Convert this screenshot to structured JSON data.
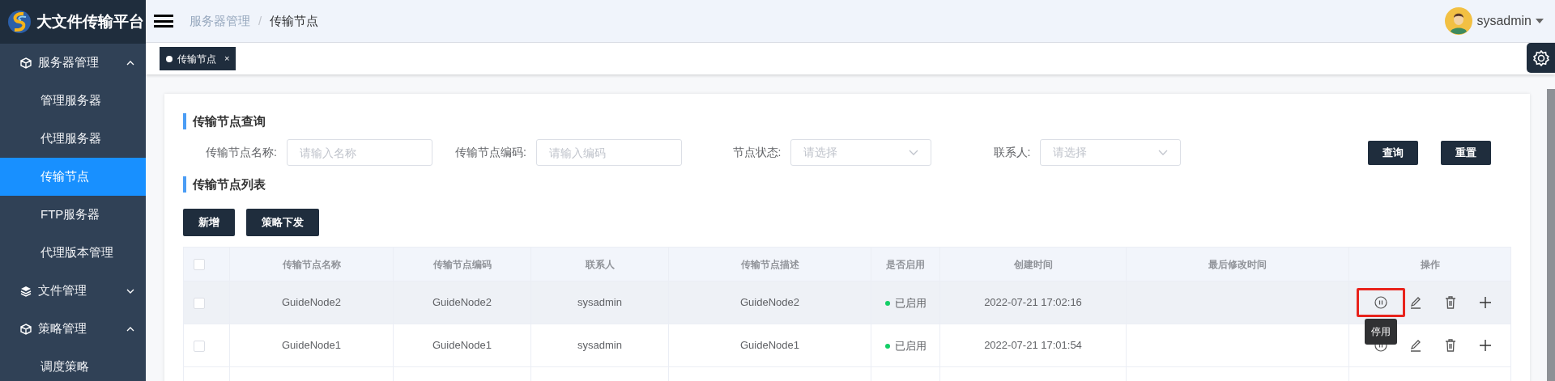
{
  "app": {
    "title": "大文件传输平台"
  },
  "sidebar": {
    "items": [
      {
        "label": "服务器管理",
        "kind": "cube",
        "expanded": true,
        "children": [
          {
            "label": "管理服务器",
            "selected": false
          },
          {
            "label": "代理服务器",
            "selected": false
          },
          {
            "label": "传输节点",
            "selected": true
          },
          {
            "label": "FTP服务器",
            "selected": false
          },
          {
            "label": "代理版本管理",
            "selected": false
          }
        ]
      },
      {
        "label": "文件管理",
        "kind": "layers",
        "expanded": false
      },
      {
        "label": "策略管理",
        "kind": "cube",
        "expanded": true,
        "children": [
          {
            "label": "调度策略",
            "selected": false
          }
        ]
      }
    ]
  },
  "breadcrumb": {
    "separator": "/",
    "items": [
      {
        "label": "服务器管理",
        "current": false
      },
      {
        "label": "传输节点",
        "current": true
      }
    ]
  },
  "user": {
    "name": "sysadmin"
  },
  "tabs": [
    {
      "label": "传输节点",
      "selected": true,
      "close": "×"
    }
  ],
  "query": {
    "title": "传输节点查询",
    "fields": [
      {
        "kind": "input",
        "label": "传输节点名称:",
        "placeholder": "请输入名称"
      },
      {
        "kind": "input",
        "label": "传输节点编码:",
        "placeholder": "请输入编码"
      },
      {
        "kind": "select",
        "label": "节点状态:",
        "placeholder": "请选择"
      },
      {
        "kind": "select",
        "label": "联系人:",
        "placeholder": "请选择"
      }
    ],
    "buttons": [
      "查询",
      "重置"
    ]
  },
  "list": {
    "title": "传输节点列表",
    "buttons": [
      "新增",
      "策略下发"
    ]
  },
  "table": {
    "header_checked": false,
    "columns": [
      "传输节点名称",
      "传输节点编码",
      "联系人",
      "传输节点描述",
      "是否启用",
      "创建时间",
      "最后修改时间",
      "操作"
    ],
    "rows": [
      {
        "checked": false,
        "hover": true,
        "cells": [
          "GuideNode2",
          "GuideNode2",
          "sysadmin",
          "GuideNode2"
        ],
        "status": {
          "enabled": true,
          "label": "已启用"
        },
        "created": "2022-07-21 17:02:16",
        "actions": [
          {
            "kind": "pause",
            "highlighted": true,
            "tooltip": "停用"
          },
          {
            "kind": "edit",
            "highlighted": false
          },
          {
            "kind": "delete",
            "highlighted": false
          },
          {
            "kind": "add",
            "highlighted": false
          }
        ]
      },
      {
        "checked": false,
        "hover": false,
        "cells": [
          "GuideNode1",
          "GuideNode1",
          "sysadmin",
          "GuideNode1"
        ],
        "status": {
          "enabled": true,
          "label": "已启用"
        },
        "created": "2022-07-21 17:01:54",
        "actions": [
          {
            "kind": "pause",
            "highlighted": false
          },
          {
            "kind": "edit",
            "highlighted": false
          },
          {
            "kind": "delete",
            "highlighted": false
          },
          {
            "kind": "add",
            "highlighted": false
          }
        ]
      }
    ]
  }
}
